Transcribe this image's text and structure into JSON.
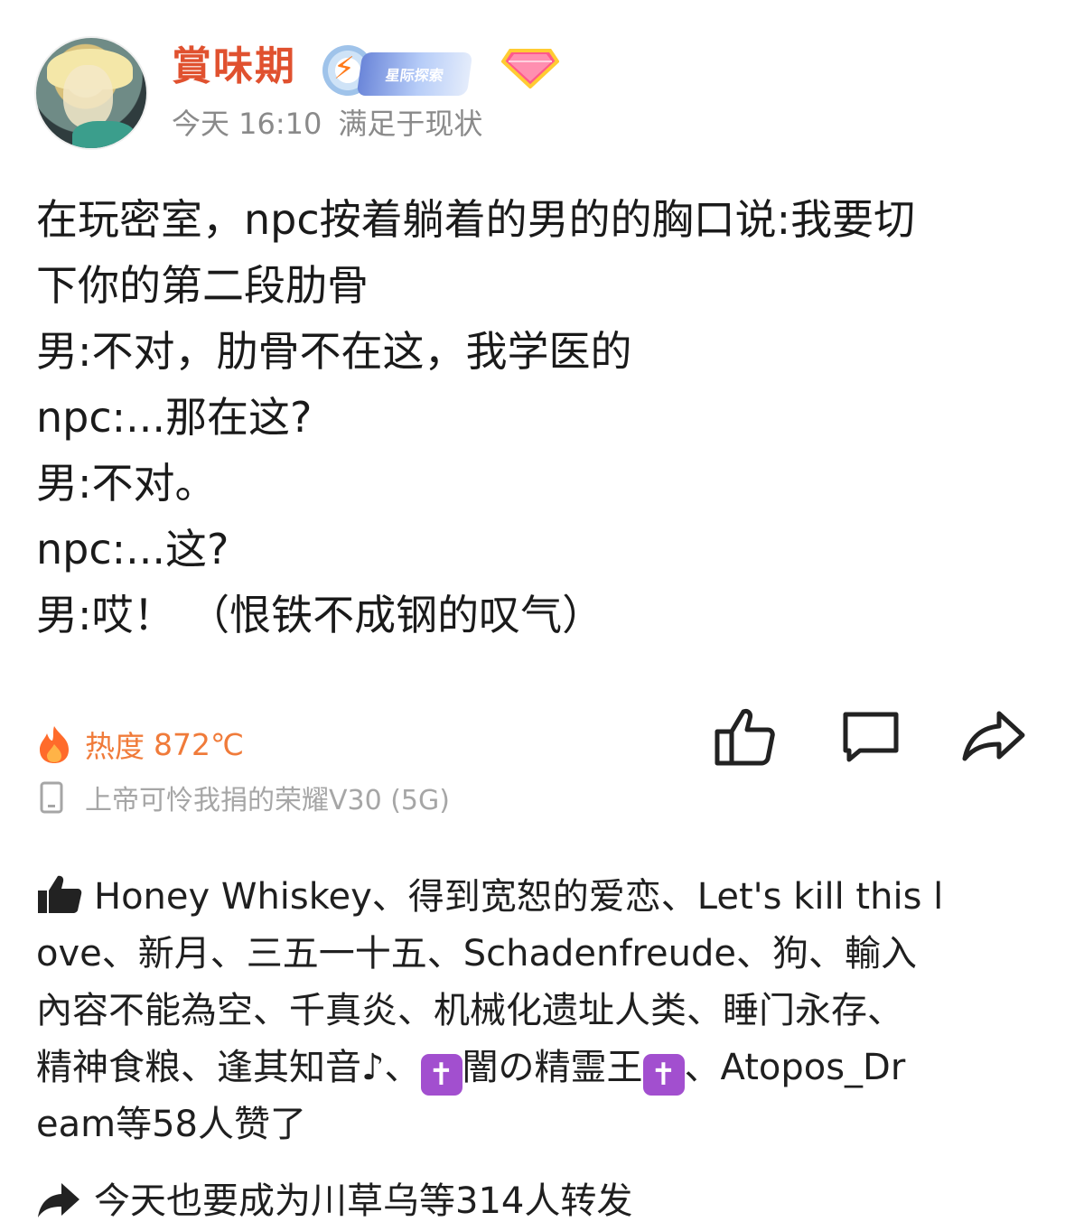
{
  "post": {
    "author": {
      "name": "賞味期",
      "badge_text": "星际探索"
    },
    "meta": {
      "time": "今天 16:10",
      "source": "满足于现状"
    },
    "content_lines": [
      "在玩密室，npc按着躺着的男的的胸口说:我要切",
      "下你的第二段肋骨",
      "男:不对，肋骨不在这，我学医的",
      "npc:...那在这?",
      "男:不对。",
      "npc:...这?",
      "男:哎！ （恨铁不成钢的叹气）"
    ],
    "heat": {
      "label": "热度",
      "value": "872℃"
    },
    "device": "上帝可怜我捐的荣耀V30 (5G)",
    "likes": {
      "line1": "Honey Whiskey、得到宽恕的爱恋、Let's kill this l",
      "line2": "ove、新月、三五一十五、Schadenfreude、狗、輸入",
      "line3": "內容不能為空、千真炎、机械化遗址人类、睡门永存、",
      "line4_a": "精神食粮、逢其知音♪、",
      "line4_name": "闇の精霊王",
      "line4_b": "、Atopos_Dr",
      "line5": "eam等58人赞了",
      "cross_glyph": "✝"
    },
    "reposts": "今天也要成为川草乌等314人转发"
  },
  "colors": {
    "username": "#e0512f",
    "meta": "#8a8a8a",
    "heat": "#f07b3a",
    "device": "#a6a6a6",
    "cross_bg": "#a24fcf"
  },
  "icons": {
    "like": "thumbs-up-icon",
    "comment": "comment-icon",
    "share": "share-icon",
    "heat": "flame-icon",
    "device": "phone-icon",
    "gem": "diamond-icon",
    "bolt": "lightning-icon"
  }
}
